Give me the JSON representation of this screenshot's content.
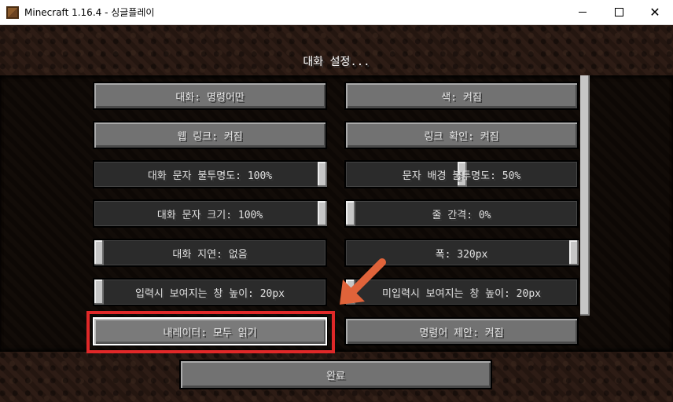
{
  "window": {
    "title": "Minecraft 1.16.4 - 싱글플레이",
    "minimize_icon": "minimize-icon",
    "maximize_icon": "maximize-icon",
    "close_icon": "close-icon",
    "close_glyph": "✕"
  },
  "screen": {
    "title": "대화 설정..."
  },
  "options": {
    "chat": "대화: 명령어만",
    "color": "색: 켜짐",
    "web_links": "웹 링크: 켜짐",
    "link_prompt": "링크 확인: 켜짐",
    "chat_opacity": {
      "label": "대화 문자 불투명도: 100%",
      "value": 1.0
    },
    "text_bg_opacity": {
      "label": "문자 배경 불투명도: 50%",
      "value": 0.5
    },
    "chat_scale": {
      "label": "대화 문자 크기: 100%",
      "value": 1.0
    },
    "line_spacing": {
      "label": "줄 간격: 0%",
      "value": 0.0
    },
    "chat_delay": {
      "label": "대화 지연: 없음",
      "value": 0.0
    },
    "width": {
      "label": "폭: 320px",
      "value": 1.0
    },
    "focused_height": {
      "label": "입력시 보여지는 창 높이: 20px",
      "value": 0.0
    },
    "unfocused_height": {
      "label": "미입력시 보여지는 창 높이: 20px",
      "value": 0.0
    },
    "narrator": "내레이터: 모두 읽기",
    "command_suggestions": "명령어 제안: 켜짐"
  },
  "done_label": "완료",
  "annotation": {
    "highlight_color": "#e02828",
    "arrow_color": "#e0633a"
  }
}
